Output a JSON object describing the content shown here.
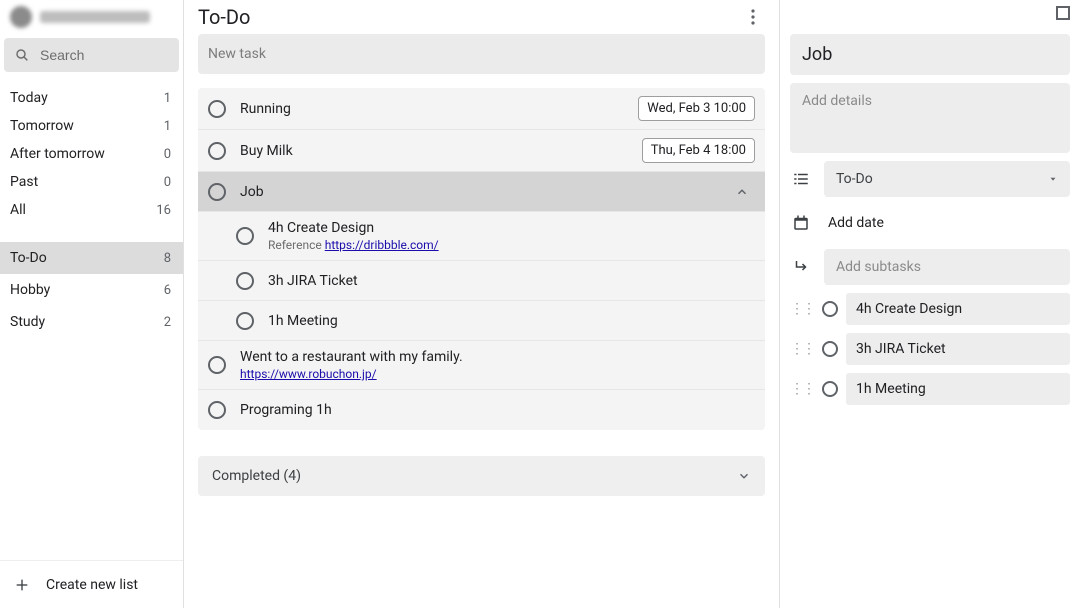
{
  "sidebar": {
    "search_placeholder": "Search",
    "filters": [
      {
        "label": "Today",
        "count": "1"
      },
      {
        "label": "Tomorrow",
        "count": "1"
      },
      {
        "label": "After tomorrow",
        "count": "0"
      },
      {
        "label": "Past",
        "count": "0"
      },
      {
        "label": "All",
        "count": "16"
      }
    ],
    "lists": [
      {
        "label": "To-Do",
        "count": "8",
        "active": true
      },
      {
        "label": "Hobby",
        "count": "6",
        "active": false
      },
      {
        "label": "Study",
        "count": "2",
        "active": false
      }
    ],
    "create_label": "Create new list"
  },
  "main": {
    "title": "To-Do",
    "new_task_placeholder": "New task",
    "tasks": [
      {
        "title": "Running",
        "date": "Wed, Feb 3 10:00"
      },
      {
        "title": "Buy Milk",
        "date": "Thu, Feb 4 18:00"
      },
      {
        "title": "Job",
        "selected": true,
        "expand": "up"
      },
      {
        "title": "4h Create Design",
        "sub": true,
        "note_prefix": "Reference ",
        "link": "https://dribbble.com/"
      },
      {
        "title": "3h JIRA Ticket",
        "sub": true
      },
      {
        "title": "1h Meeting",
        "sub": true
      },
      {
        "title": "Went to a restaurant with my family.",
        "link_full": "https://www.robuchon.jp/"
      },
      {
        "title": "Programing 1h"
      }
    ],
    "completed_label": "Completed (4)"
  },
  "details": {
    "title": "Job",
    "desc_placeholder": "Add details",
    "list_value": "To-Do",
    "add_date_label": "Add date",
    "add_subtasks_placeholder": "Add subtasks",
    "subtasks": [
      {
        "label": "4h Create Design"
      },
      {
        "label": "3h JIRA Ticket"
      },
      {
        "label": "1h Meeting"
      }
    ]
  }
}
